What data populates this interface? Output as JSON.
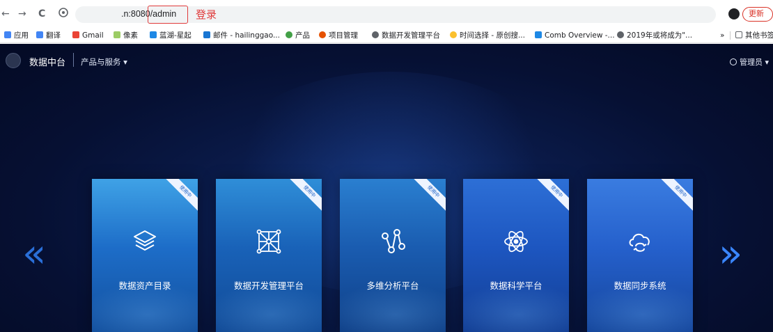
{
  "browser": {
    "back": "←",
    "forward": "→",
    "reload": "C",
    "url": ".n:8080/admin",
    "annotation": "登录",
    "update_button": "更新",
    "bookmarks": [
      {
        "label": "应用",
        "color": "#4285f4"
      },
      {
        "label": "翻译",
        "color": "#4285f4"
      },
      {
        "label": "Gmail",
        "color": "#ea4335"
      },
      {
        "label": "像素",
        "color": "#9ccc65"
      },
      {
        "label": "蓝湖-星起",
        "color": "#1e88e5"
      },
      {
        "label": "邮件 - hailinggao...",
        "color": "#1976d2"
      },
      {
        "label": "产品",
        "color": "#43a047"
      },
      {
        "label": "项目管理",
        "color": "#e65100"
      },
      {
        "label": "数据开发管理平台",
        "color": "#5f6368"
      },
      {
        "label": "时间选择 - 原创搜...",
        "color": "#fbc02d"
      },
      {
        "label": "Comb Overview -...",
        "color": "#1e88e5"
      },
      {
        "label": "2019年或将成为\"...",
        "color": "#5f6368"
      }
    ],
    "more_chevron": "»",
    "other_bookmarks": "其他书签"
  },
  "app": {
    "brand": "数据中台",
    "products_menu": "产品与服务 ▾",
    "user_menu": "管理员 ▾",
    "nav_prev": "«",
    "nav_next": "»",
    "cards": [
      {
        "title": "数据资产目录",
        "status": "使用中",
        "icon": "layers-icon"
      },
      {
        "title": "数据开发管理平台",
        "status": "使用中",
        "icon": "network-grid-icon"
      },
      {
        "title": "多维分析平台",
        "status": "使用中",
        "icon": "node-graph-icon"
      },
      {
        "title": "数据科学平台",
        "status": "使用中",
        "icon": "atom-icon"
      },
      {
        "title": "数据同步系统",
        "status": "使用中",
        "icon": "cloud-sync-icon"
      }
    ],
    "colors": {
      "accent": "#3a86ff",
      "background": "#061033",
      "annotation": "#e03a3a"
    }
  }
}
